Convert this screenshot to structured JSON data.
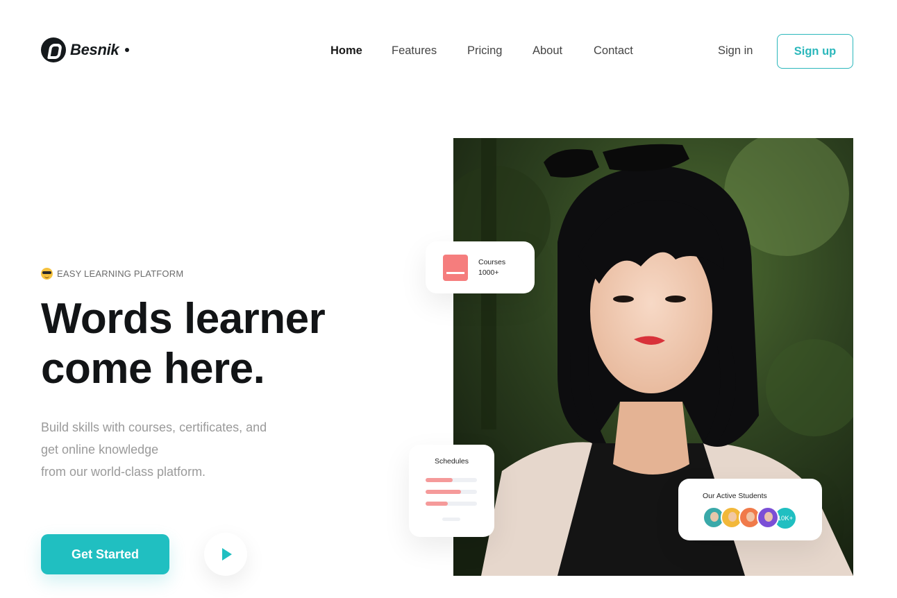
{
  "brand": {
    "name": "Besnik"
  },
  "nav": {
    "items": [
      {
        "label": "Home",
        "active": true
      },
      {
        "label": "Features",
        "active": false
      },
      {
        "label": "Pricing",
        "active": false
      },
      {
        "label": "About",
        "active": false
      },
      {
        "label": "Contact",
        "active": false
      }
    ],
    "signin_label": "Sign in",
    "signup_label": "Sign up"
  },
  "hero": {
    "eyebrow": "EASY LEARNING PLATFORM",
    "headline_line1": "Words learner",
    "headline_line2": "come here.",
    "subtext_line1": "Build skills with courses, certificates, and",
    "subtext_line2": "get online knowledge",
    "subtext_line3": "from our world-class platform.",
    "cta_label": "Get Started"
  },
  "cards": {
    "courses": {
      "label": "Courses",
      "value": "1000+"
    },
    "schedules": {
      "title": "Schedules",
      "bars": [
        0.53,
        0.69,
        0.43
      ]
    },
    "students": {
      "title": "Our Active Students",
      "count": "10K+"
    }
  },
  "colors": {
    "accent": "#20bfc1",
    "dark": "#121416",
    "coral": "#f57d7d",
    "muted": "#9a9a9a"
  }
}
